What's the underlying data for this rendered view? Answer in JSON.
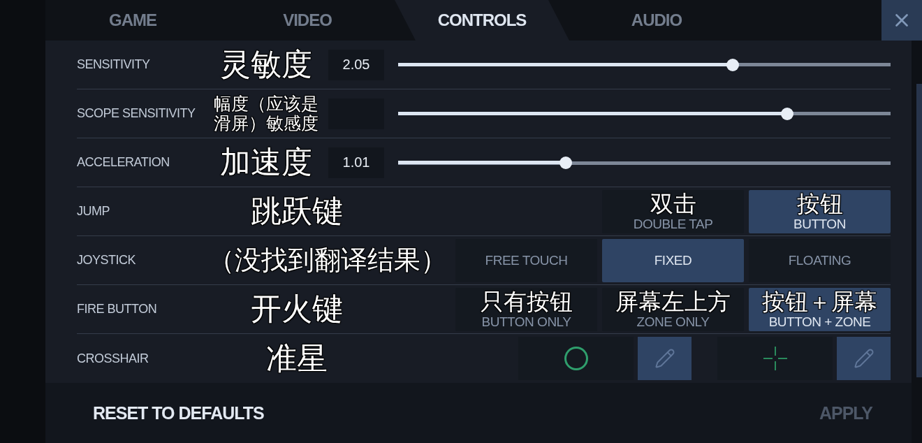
{
  "tabs": [
    {
      "label": "GAME",
      "selected": false
    },
    {
      "label": "VIDEO",
      "selected": false
    },
    {
      "label": "CONTROLS",
      "selected": true
    },
    {
      "label": "AUDIO",
      "selected": false
    }
  ],
  "rows": [
    {
      "kind": "slider",
      "label": "SENSITIVITY",
      "note": "灵敏度",
      "value": "2.05",
      "level": 0.68
    },
    {
      "kind": "slider",
      "label": "SCOPE SENSITIVITY",
      "note": "幅度（应该是滑屏）敏感度",
      "level": 0.79
    },
    {
      "kind": "slider",
      "label": "ACCELERATION",
      "note": "加速度",
      "value": "1.01",
      "level": 0.34
    },
    {
      "kind": "options",
      "label": "JUMP",
      "note": "跳跃键",
      "options": [
        {
          "label": "DOUBLE TAP",
          "note": "双击",
          "selected": false
        },
        {
          "label": "BUTTON",
          "note": "按钮",
          "selected": true
        }
      ]
    },
    {
      "kind": "options",
      "label": "JOYSTICK",
      "note": "（没找到翻译结果）",
      "options": [
        {
          "label": "FREE TOUCH",
          "selected": false
        },
        {
          "label": "FIXED",
          "selected": true
        },
        {
          "label": "FLOATING",
          "selected": false
        }
      ]
    },
    {
      "kind": "options",
      "label": "FIRE BUTTON",
      "note": "开火键",
      "options": [
        {
          "label": "BUTTON ONLY",
          "note": "只有按钮",
          "selected": false
        },
        {
          "label": "ZONE ONLY",
          "note": "屏幕左上方",
          "selected": false
        },
        {
          "label": "BUTTON + ZONE",
          "note": "按钮＋屏幕",
          "selected": true
        }
      ]
    },
    {
      "kind": "crosshair",
      "label": "CROSSHAIR",
      "note": "准星",
      "crosshairs": [
        {
          "kind": "circle"
        },
        {
          "kind": "cross"
        }
      ]
    }
  ],
  "footer": {
    "buttons": [
      {
        "label": "RESET TO DEFAULTS",
        "disabled": false
      },
      {
        "label": "APPLY",
        "disabled": true
      }
    ]
  }
}
